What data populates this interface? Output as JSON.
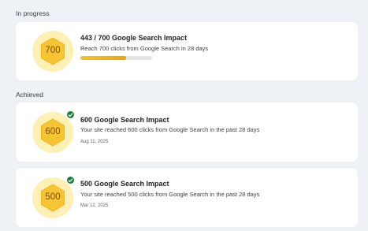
{
  "in_progress": {
    "section_label": "In progress",
    "badge_value": "700",
    "title": "443 / 700 Google Search Impact",
    "description": "Reach 700 clicks from Google Search in 28 days",
    "progress_fraction": 0.633
  },
  "achieved": {
    "section_label": "Achieved",
    "items": [
      {
        "badge_value": "600",
        "title": "600 Google Search Impact",
        "description": "Your site reached 600 clicks from Google Search in the past 28 days",
        "date": "Aug 11, 2025"
      },
      {
        "badge_value": "500",
        "title": "500 Google Search Impact",
        "description": "Your site reached 500 clicks from Google Search in the past 28 days",
        "date": "Mar 12, 2025"
      }
    ]
  },
  "colors": {
    "badge_outer": "#fdf0b4",
    "hexagon": "#f7c533",
    "progress_fill": "#f0a500",
    "check": "#188038"
  },
  "icons": {
    "badge": "hexagon-badge-icon",
    "achieved": "check-circle-icon"
  }
}
